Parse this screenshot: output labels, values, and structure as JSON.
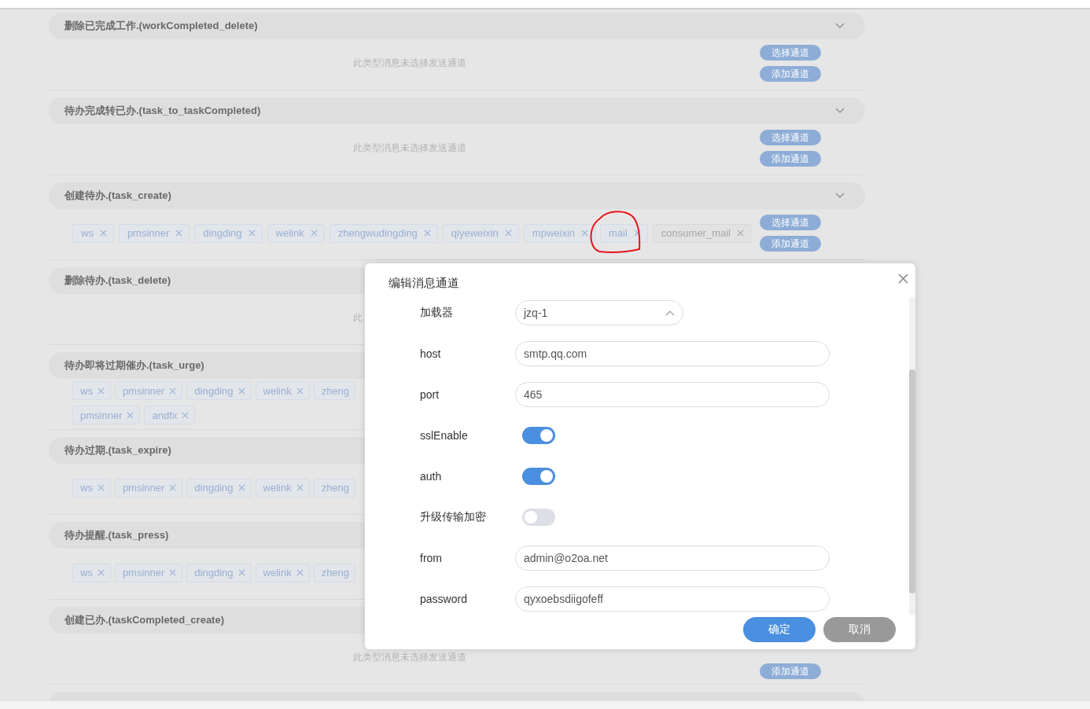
{
  "sections": [
    {
      "title": "删除已完成工作.(workCompleted_delete)",
      "empty_text": "此类型消息未选择发送通道",
      "buttons": [
        "选择通道",
        "添加通道"
      ]
    },
    {
      "title": "待办完成转已办.(task_to_taskCompleted)",
      "empty_text": "此类型消息未选择发送通道",
      "buttons": [
        "选择通道",
        "添加通道"
      ]
    },
    {
      "title": "创建待办.(task_create)",
      "tags": [
        {
          "label": "ws",
          "disabled": false
        },
        {
          "label": "pmsinner",
          "disabled": false
        },
        {
          "label": "dingding",
          "disabled": false
        },
        {
          "label": "welink",
          "disabled": false
        },
        {
          "label": "zhengwudingding",
          "disabled": false
        },
        {
          "label": "qiyeweixin",
          "disabled": false
        },
        {
          "label": "mpweixin",
          "disabled": false
        },
        {
          "label": "mail",
          "disabled": false
        },
        {
          "label": "consumer_mail",
          "disabled": true
        }
      ],
      "buttons": [
        "选择通道",
        "添加通道"
      ]
    },
    {
      "title": "删除待办.(task_delete)",
      "empty_text": "此"
    },
    {
      "title": "待办即将过期催办.(task_urge)",
      "tags": [
        {
          "label": "ws",
          "disabled": false
        },
        {
          "label": "pmsinner",
          "disabled": false
        },
        {
          "label": "dingding",
          "disabled": false
        },
        {
          "label": "welink",
          "disabled": false
        },
        {
          "label": "zheng",
          "disabled": false,
          "cut": true
        },
        {
          "label": "pmsinner",
          "disabled": false
        },
        {
          "label": "andfx",
          "disabled": false
        }
      ]
    },
    {
      "title": "待办过期.(task_expire)",
      "tags": [
        {
          "label": "ws",
          "disabled": false
        },
        {
          "label": "pmsinner",
          "disabled": false
        },
        {
          "label": "dingding",
          "disabled": false
        },
        {
          "label": "welink",
          "disabled": false
        },
        {
          "label": "zheng",
          "disabled": false,
          "cut": true
        }
      ]
    },
    {
      "title": "待办提醒.(task_press)",
      "tags": [
        {
          "label": "ws",
          "disabled": false
        },
        {
          "label": "pmsinner",
          "disabled": false
        },
        {
          "label": "dingding",
          "disabled": false
        },
        {
          "label": "welink",
          "disabled": false
        },
        {
          "label": "zheng",
          "disabled": false,
          "cut": true
        }
      ]
    },
    {
      "title": "创建已办.(taskCompleted_create)",
      "empty_text": "此类型消息未选择发送通道",
      "buttons": [
        "添加通道"
      ]
    }
  ],
  "dialog": {
    "title": "编辑消息通道",
    "fields": [
      {
        "kind": "select",
        "label": "加载器",
        "value": "jzq-1"
      },
      {
        "kind": "input",
        "label": "host",
        "value": "smtp.qq.com"
      },
      {
        "kind": "input",
        "label": "port",
        "value": "465"
      },
      {
        "kind": "switch",
        "label": "sslEnable",
        "on": true
      },
      {
        "kind": "switch",
        "label": "auth",
        "on": true
      },
      {
        "kind": "switch",
        "label": "升级传输加密",
        "on": false
      },
      {
        "kind": "input",
        "label": "from",
        "value": "admin@o2oa.net"
      },
      {
        "kind": "input",
        "label": "password",
        "value": "qyxoebsdiigofeff"
      }
    ],
    "buttons": [
      {
        "label": "确定",
        "kind": "primary"
      },
      {
        "label": "取消",
        "kind": "secondary"
      }
    ]
  }
}
